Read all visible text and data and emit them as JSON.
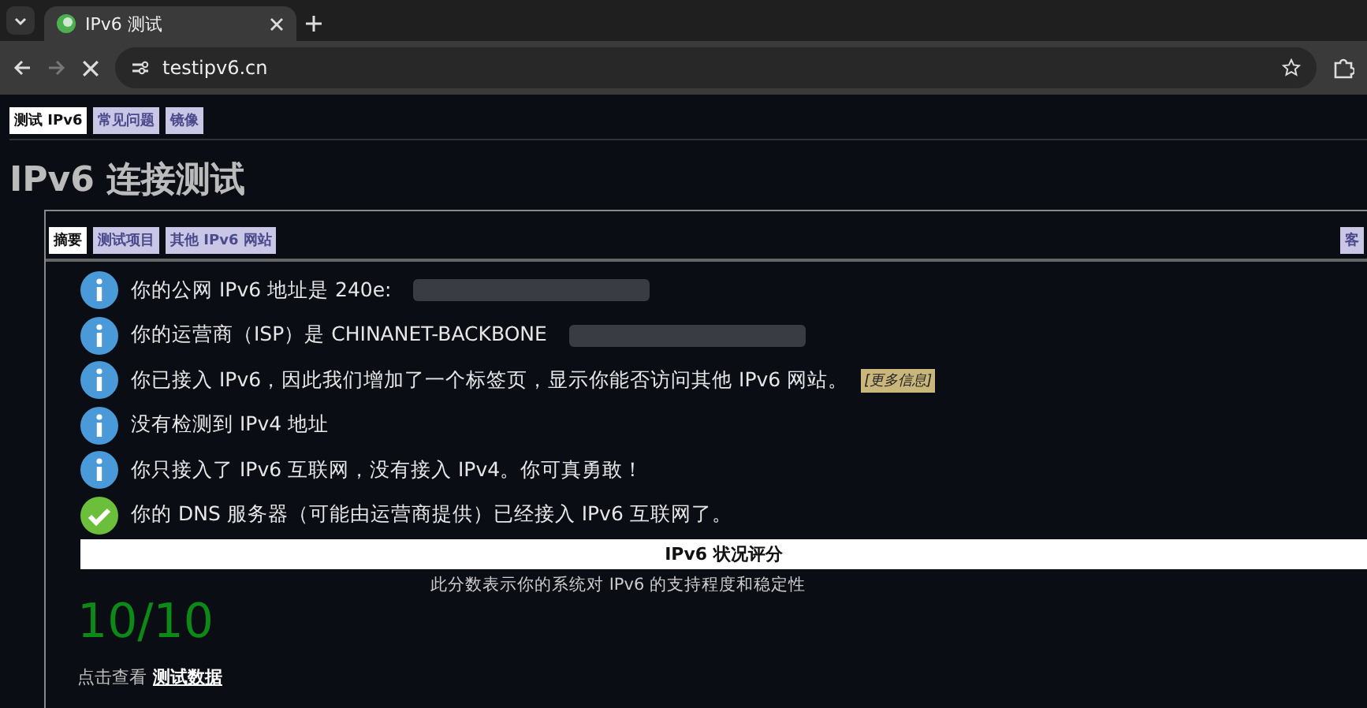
{
  "browser": {
    "tab_title": "IPv6 测试",
    "url": "testipv6.cn",
    "loading": true
  },
  "nav_tabs": [
    {
      "label": "测试 IPv6",
      "selected": true
    },
    {
      "label": "常见问题",
      "selected": false
    },
    {
      "label": "镜像",
      "selected": false
    }
  ],
  "heading": "IPv6 连接测试",
  "panel_tabs": [
    {
      "label": "摘要",
      "selected": true
    },
    {
      "label": "测试项目",
      "selected": false
    },
    {
      "label": "其他 IPv6 网站",
      "selected": false
    }
  ],
  "panel_tab_right": {
    "label": "客",
    "selected": false
  },
  "results": [
    {
      "kind": "info",
      "text": "你的公网 IPv6 地址是 240e:",
      "redacted": true
    },
    {
      "kind": "info",
      "text": "你的运营商（ISP）是 CHINANET-BACKBONE",
      "redacted": true
    },
    {
      "kind": "info",
      "text": "你已接入 IPv6，因此我们增加了一个标签页，显示你能否访问其他 IPv6 网站。",
      "link": "[更多信息]",
      "redacted": false
    },
    {
      "kind": "info",
      "text": "没有检测到 IPv4 地址",
      "redacted": false
    },
    {
      "kind": "info",
      "text": "你只接入了 IPv6 互联网，没有接入 IPv4。你可真勇敢！",
      "redacted": false
    },
    {
      "kind": "ok",
      "text": "你的 DNS 服务器（可能由运营商提供）已经接入 IPv6 互联网了。",
      "redacted": false
    }
  ],
  "score": {
    "title": "IPv6 状况评分",
    "description": "此分数表示你的系统对 IPv6 的支持程度和稳定性",
    "value": "10/10"
  },
  "footer": {
    "prefix": "点击查看",
    "link": "测试数据"
  }
}
